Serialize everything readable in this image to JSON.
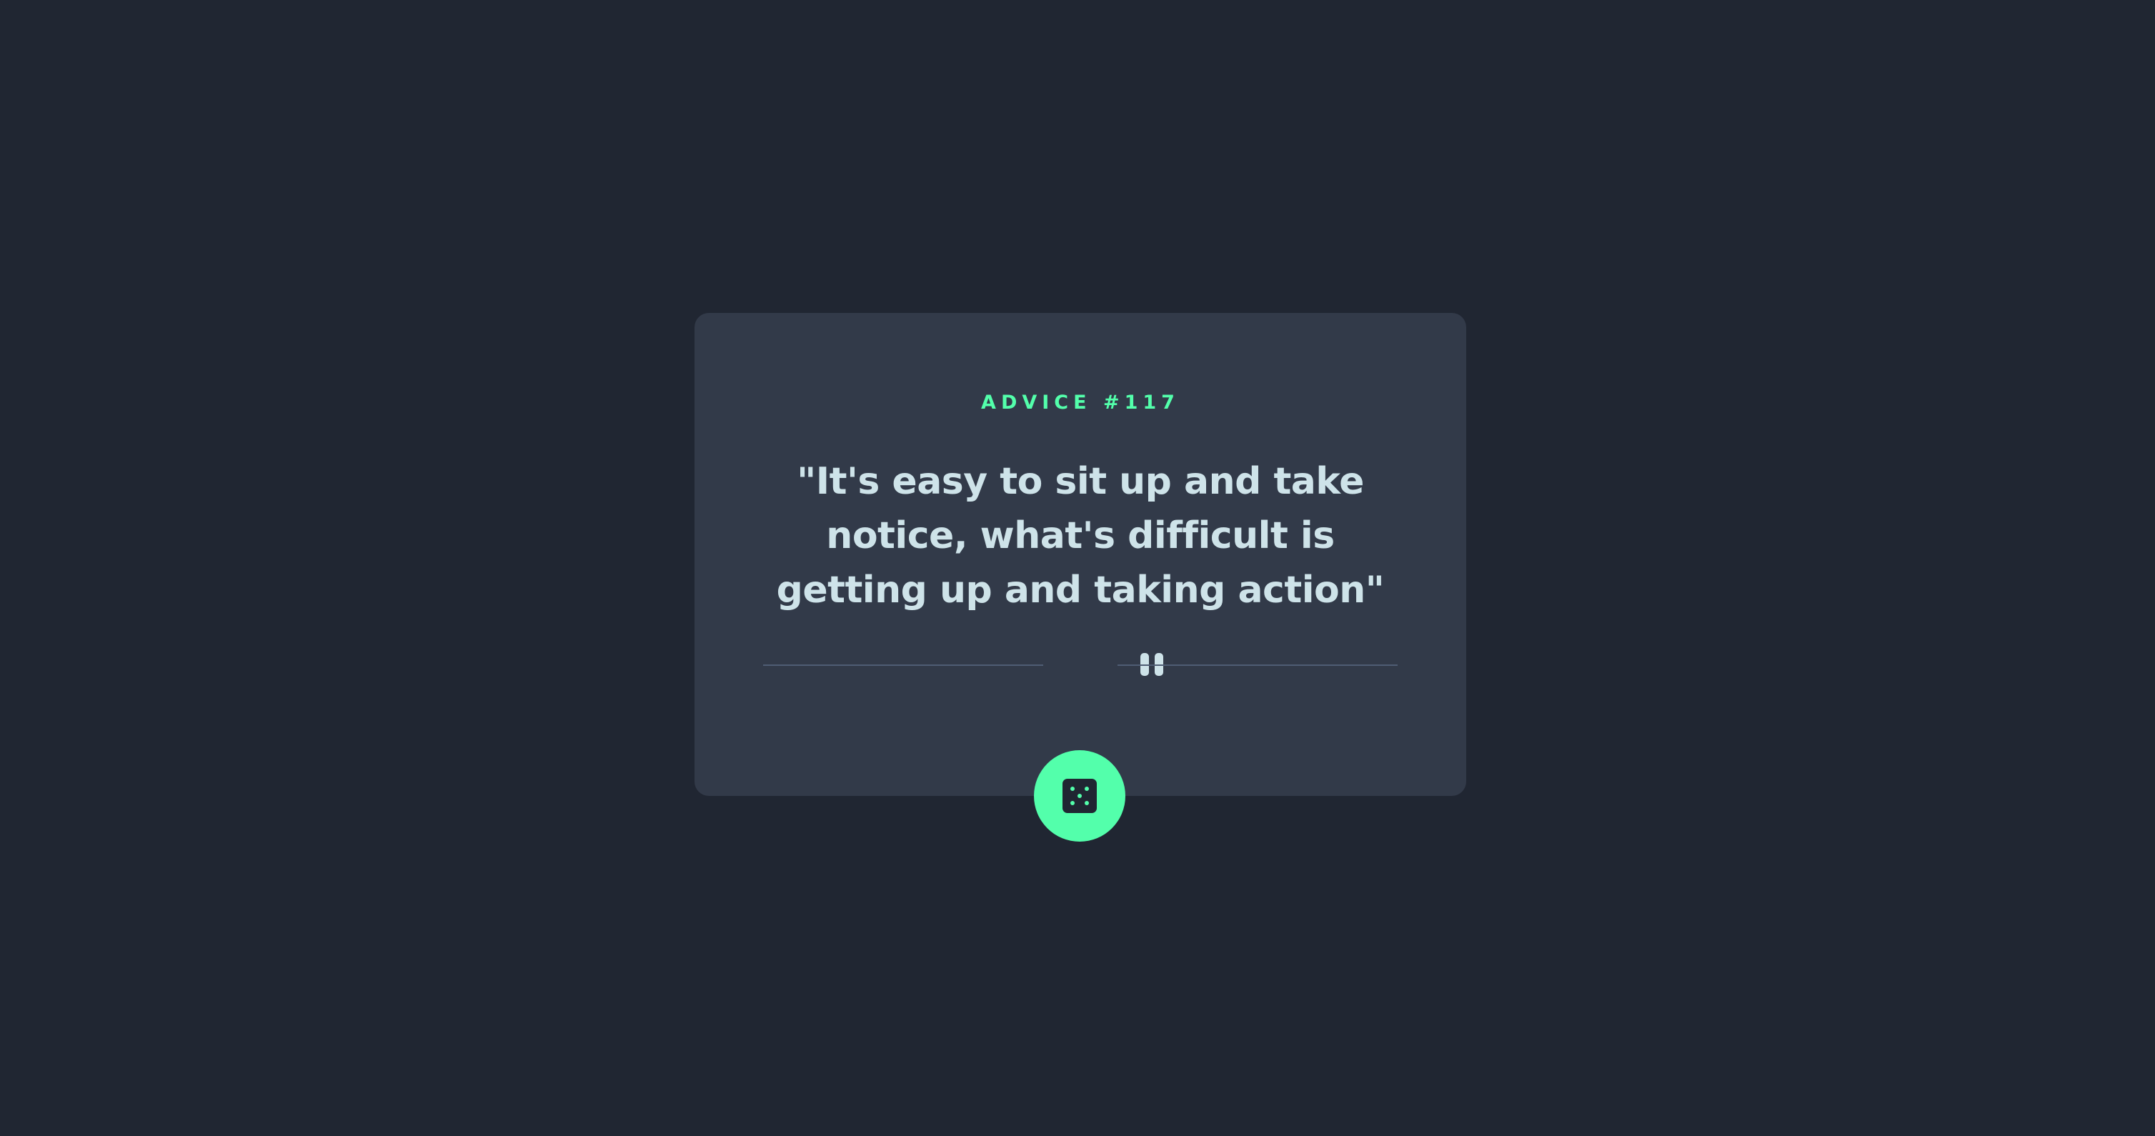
{
  "advice": {
    "label": "ADVICE #117",
    "quote": "\"It's easy to sit up and take notice, what's difficult is getting up and taking action\""
  },
  "divider": {
    "icon": "pause-icon"
  },
  "generate_button": {
    "icon": "dice-icon"
  },
  "colors": {
    "background": "#202632",
    "card": "#323a49",
    "accent": "#53ffab",
    "text": "#cee3e9",
    "divider": "#4f5d74"
  }
}
